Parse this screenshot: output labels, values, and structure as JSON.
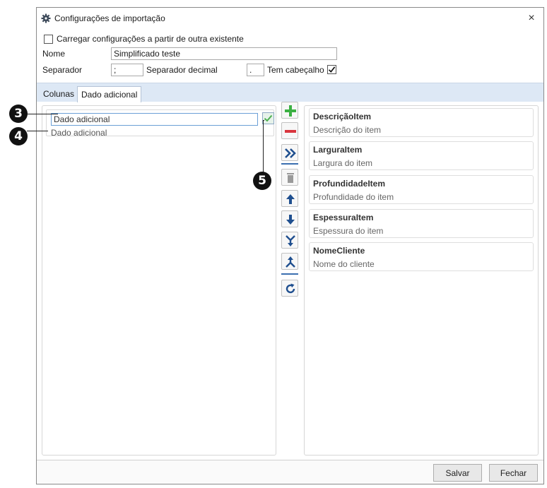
{
  "window": {
    "title": "Configurações de importação",
    "close_label": "×"
  },
  "options": {
    "load_existing_label": "Carregar configurações a partir de outra existente",
    "load_existing_checked": false,
    "name_label": "Nome",
    "name_value": "Simplificado teste",
    "separator_label": "Separador",
    "separator_value": ";",
    "decimal_label": "Separador decimal",
    "decimal_value": ".",
    "header_label": "Tem cabeçalho",
    "header_checked": true
  },
  "tabs": [
    {
      "label": "Colunas",
      "active": false
    },
    {
      "label": "Dado adicional",
      "active": true
    }
  ],
  "editor": {
    "input_value": "Dado adicional",
    "description": "Dado adicional"
  },
  "toolbar": {
    "icons": [
      "plus-icon",
      "minus-icon",
      "double-chevron-right-icon",
      "trash-icon",
      "arrow-up-icon",
      "arrow-down-icon",
      "merge-down-icon",
      "split-up-icon",
      "refresh-icon"
    ]
  },
  "fields": [
    {
      "name": "DescriçãoItem",
      "description": "Descrição do item"
    },
    {
      "name": "LarguraItem",
      "description": "Largura do item"
    },
    {
      "name": "ProfundidadeItem",
      "description": "Profundidade do item"
    },
    {
      "name": "EspessuraItem",
      "description": "Espessura do item"
    },
    {
      "name": "NomeCliente",
      "description": "Nome do cliente"
    }
  ],
  "footer": {
    "save_label": "Salvar",
    "close_label": "Fechar"
  },
  "callouts": [
    "3",
    "4",
    "5"
  ],
  "colors": {
    "accent": "#3b6fb0",
    "add_green": "#3cb043",
    "remove_red": "#d9363e",
    "tab_strip": "#dde8f5"
  }
}
